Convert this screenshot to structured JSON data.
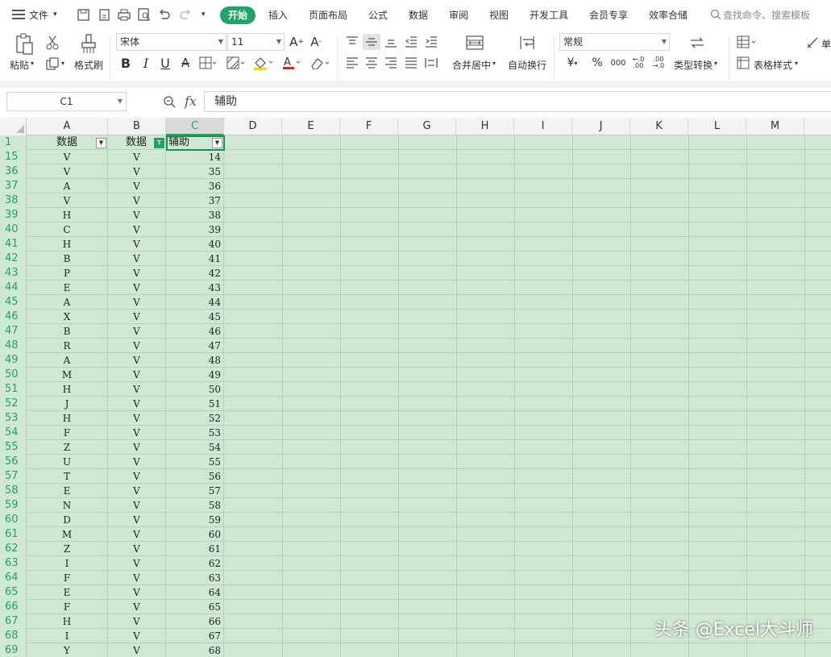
{
  "menu": {
    "file": "文件",
    "tabs": [
      "开始",
      "插入",
      "页面布局",
      "公式",
      "数据",
      "审阅",
      "视图",
      "开发工具",
      "会员专享",
      "效率合储"
    ],
    "search_placeholder": "查找命令、搜索模板"
  },
  "ribbon": {
    "paste": "粘贴",
    "format_painter": "格式刷",
    "font_name": "宋体",
    "font_size": "11",
    "merge_center": "合并居中",
    "wrap_text": "自动换行",
    "number_format": "常规",
    "type_convert": "类型转换",
    "table_style": "表格样式",
    "single": "单"
  },
  "formula_bar": {
    "cell_ref": "C1",
    "fx": "fx",
    "value": "辅助"
  },
  "columns": [
    "A",
    "B",
    "C",
    "D",
    "E",
    "F",
    "G",
    "H",
    "I",
    "J",
    "K",
    "L",
    "M"
  ],
  "header_row": {
    "row": "1",
    "a": "数据",
    "b": "数据",
    "c": "辅助"
  },
  "rows": [
    {
      "r": "15",
      "a": "V",
      "b": "V",
      "c": "14"
    },
    {
      "r": "36",
      "a": "V",
      "b": "V",
      "c": "35"
    },
    {
      "r": "37",
      "a": "A",
      "b": "V",
      "c": "36"
    },
    {
      "r": "38",
      "a": "V",
      "b": "V",
      "c": "37"
    },
    {
      "r": "39",
      "a": "H",
      "b": "V",
      "c": "38"
    },
    {
      "r": "40",
      "a": "C",
      "b": "V",
      "c": "39"
    },
    {
      "r": "41",
      "a": "H",
      "b": "V",
      "c": "40"
    },
    {
      "r": "42",
      "a": "B",
      "b": "V",
      "c": "41"
    },
    {
      "r": "43",
      "a": "P",
      "b": "V",
      "c": "42"
    },
    {
      "r": "44",
      "a": "E",
      "b": "V",
      "c": "43"
    },
    {
      "r": "45",
      "a": "A",
      "b": "V",
      "c": "44"
    },
    {
      "r": "46",
      "a": "X",
      "b": "V",
      "c": "45"
    },
    {
      "r": "47",
      "a": "B",
      "b": "V",
      "c": "46"
    },
    {
      "r": "48",
      "a": "R",
      "b": "V",
      "c": "47"
    },
    {
      "r": "49",
      "a": "A",
      "b": "V",
      "c": "48"
    },
    {
      "r": "50",
      "a": "M",
      "b": "V",
      "c": "49"
    },
    {
      "r": "51",
      "a": "H",
      "b": "V",
      "c": "50"
    },
    {
      "r": "52",
      "a": "J",
      "b": "V",
      "c": "51"
    },
    {
      "r": "53",
      "a": "H",
      "b": "V",
      "c": "52"
    },
    {
      "r": "54",
      "a": "F",
      "b": "V",
      "c": "53"
    },
    {
      "r": "55",
      "a": "Z",
      "b": "V",
      "c": "54"
    },
    {
      "r": "56",
      "a": "U",
      "b": "V",
      "c": "55"
    },
    {
      "r": "57",
      "a": "T",
      "b": "V",
      "c": "56"
    },
    {
      "r": "58",
      "a": "E",
      "b": "V",
      "c": "57"
    },
    {
      "r": "59",
      "a": "N",
      "b": "V",
      "c": "58"
    },
    {
      "r": "60",
      "a": "D",
      "b": "V",
      "c": "59"
    },
    {
      "r": "61",
      "a": "M",
      "b": "V",
      "c": "60"
    },
    {
      "r": "62",
      "a": "Z",
      "b": "V",
      "c": "61"
    },
    {
      "r": "63",
      "a": "I",
      "b": "V",
      "c": "62"
    },
    {
      "r": "64",
      "a": "F",
      "b": "V",
      "c": "63"
    },
    {
      "r": "65",
      "a": "E",
      "b": "V",
      "c": "64"
    },
    {
      "r": "66",
      "a": "F",
      "b": "V",
      "c": "65"
    },
    {
      "r": "67",
      "a": "H",
      "b": "V",
      "c": "66"
    },
    {
      "r": "68",
      "a": "I",
      "b": "V",
      "c": "67"
    },
    {
      "r": "69",
      "a": "Y",
      "b": "V",
      "c": "68"
    }
  ],
  "watermark": "头条 @Excel大斗师",
  "colors": {
    "accent": "#21a366",
    "grid_bg": "#cfe8d1",
    "row_number": "#21a366"
  }
}
